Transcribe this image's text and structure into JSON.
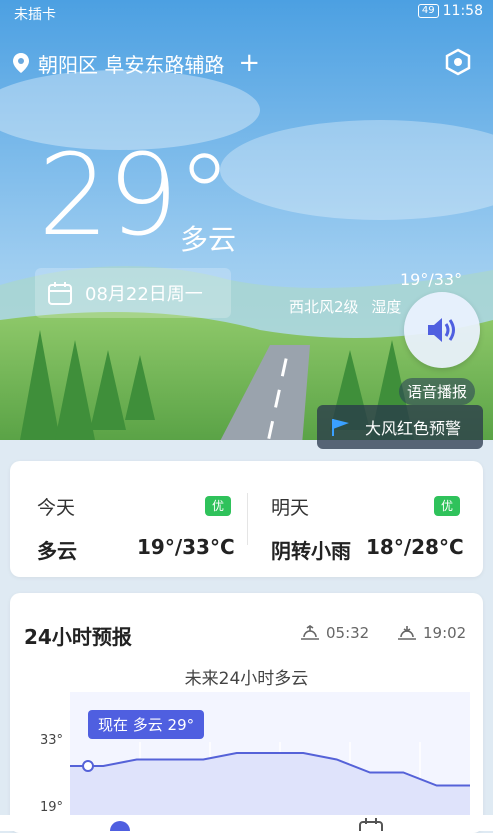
{
  "status_bar": {
    "carrier": "未插卡",
    "battery": "49",
    "time": "11:58"
  },
  "location": {
    "name": "朝阳区 阜安东路辅路",
    "add": "+"
  },
  "current": {
    "temperature": "29°",
    "condition": "多云",
    "date": "08月22日周一",
    "range": "19°/33°",
    "wind": "西北风2级",
    "humidity_partial": "湿度"
  },
  "voice": {
    "label": "语音播报"
  },
  "alert": {
    "text": "大风红色预警"
  },
  "days": [
    {
      "label": "今天",
      "aqi": "优",
      "condition": "多云",
      "temps": "19°/33°C"
    },
    {
      "label": "明天",
      "aqi": "优",
      "condition": "阴转小雨",
      "temps": "18°/28°C"
    }
  ],
  "forecast": {
    "title": "24小时预报",
    "sunrise": "05:32",
    "sunset": "19:02",
    "summary": "未来24小时多云",
    "now_tag": "现在 多云 29°",
    "y_max": "33°",
    "y_min": "19°",
    "temps": [
      29,
      29,
      30,
      30,
      30,
      31,
      31,
      31,
      30,
      28,
      28,
      26,
      26
    ]
  },
  "colors": {
    "accent": "#4f5fe0",
    "badge": "#2fc25b"
  }
}
